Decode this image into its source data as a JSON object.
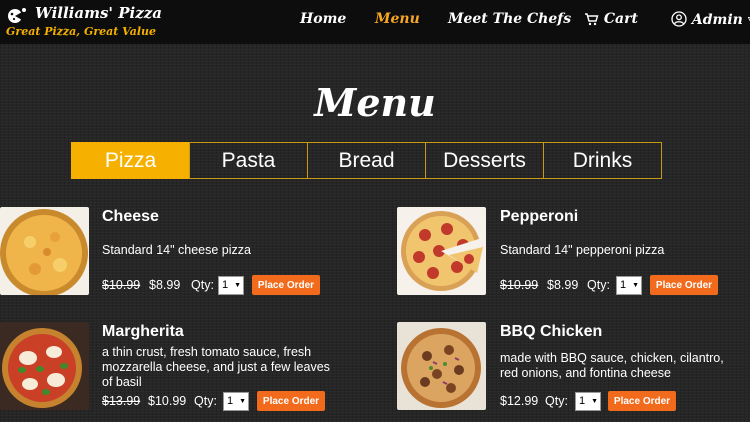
{
  "brand": {
    "name": "Williams' Pizza",
    "tagline": "Great Pizza, Great Value"
  },
  "nav": {
    "items": [
      {
        "label": "Home"
      },
      {
        "label": "Menu",
        "active": true
      },
      {
        "label": "Meet The Chefs"
      },
      {
        "label": "Cart"
      },
      {
        "label": "Admin ▿"
      }
    ]
  },
  "page": {
    "title": "Menu"
  },
  "tabs": [
    {
      "label": "Pizza",
      "active": true
    },
    {
      "label": "Pasta"
    },
    {
      "label": "Bread"
    },
    {
      "label": "Desserts"
    },
    {
      "label": "Drinks"
    }
  ],
  "items": [
    {
      "name": "Cheese",
      "description": "Standard 14\" cheese pizza",
      "old_price": "$10.99",
      "price": "$8.99",
      "qty_label": "Qty:",
      "qty": "1",
      "button": "Place Order"
    },
    {
      "name": "Pepperoni",
      "description": "Standard 14\" pepperoni pizza",
      "old_price": "$10.99",
      "price": "$8.99",
      "qty_label": "Qty:",
      "qty": "1",
      "button": "Place Order"
    },
    {
      "name": "Margherita",
      "description": "a thin crust, fresh tomato sauce, fresh mozzarella cheese, and just a few leaves of basil",
      "old_price": "$13.99",
      "price": "$10.99",
      "qty_label": "Qty:",
      "qty": "1",
      "button": "Place Order"
    },
    {
      "name": "BBQ Chicken",
      "description": "made with BBQ sauce, chicken, cilantro, red onions, and fontina cheese",
      "price": "$12.99",
      "qty_label": "Qty:",
      "qty": "1",
      "button": "Place Order"
    }
  ],
  "colors": {
    "accent": "#f5b000",
    "button": "#f26a1b",
    "topbar": "#0d0d0d",
    "active_nav": "#f5a623"
  }
}
